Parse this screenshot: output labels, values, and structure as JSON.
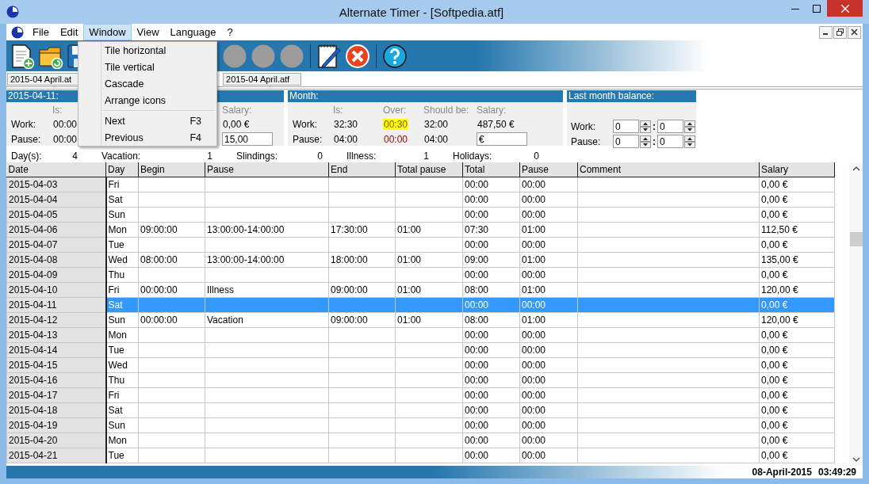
{
  "window": {
    "title": "Alternate Timer - [Softpedia.atf]"
  },
  "menu_bar": [
    {
      "label": "File",
      "selected": false
    },
    {
      "label": "Edit",
      "selected": false
    },
    {
      "label": "Window",
      "selected": true
    },
    {
      "label": "View",
      "selected": false
    },
    {
      "label": "Language",
      "selected": false
    },
    {
      "label": "?",
      "selected": false
    }
  ],
  "toolbar": [
    {
      "kind": "new"
    },
    {
      "kind": "open"
    },
    {
      "kind": "save"
    },
    {
      "kind": "disabled"
    },
    {
      "kind": "disabled"
    },
    {
      "kind": "disabled"
    },
    {
      "kind": "divider"
    },
    {
      "kind": "notes"
    },
    {
      "kind": "close"
    },
    {
      "kind": "divider"
    },
    {
      "kind": "help"
    }
  ],
  "document_tabs": [
    {
      "label": "2015-04 April.at"
    },
    {
      "label": "2015-04 April.atf"
    }
  ],
  "day_panel": {
    "title": "2015-04-11:",
    "headers": [
      "Is:",
      "Salary:"
    ],
    "rows": [
      {
        "label": "Work:",
        "is": "00:00",
        "salary": "0,00 €"
      },
      {
        "label": "Pause:",
        "is": "00:00",
        "salary_field": "15,00"
      }
    ]
  },
  "month_panel": {
    "title": "Month:",
    "headers": [
      "Is:",
      "Over:",
      "Should be:",
      "Salary:"
    ],
    "rows": [
      {
        "label": "Work:",
        "cells": [
          {
            "text": "32:30",
            "kind": "plain"
          },
          {
            "text": "00:30",
            "kind": "highlight"
          },
          {
            "text": "32:00",
            "kind": "plain"
          },
          {
            "text": "487,50 €",
            "kind": "plain"
          }
        ]
      },
      {
        "label": "Pause:",
        "cells": [
          {
            "text": "04:00",
            "kind": "plain"
          },
          {
            "text": "00:00",
            "kind": "alert"
          },
          {
            "text": "04:00",
            "kind": "plain"
          }
        ],
        "salary_field": "€"
      }
    ]
  },
  "balance_panel": {
    "title": "Last month balance:",
    "rows": [
      {
        "label": "Work:",
        "hours": "0",
        "separator": ":",
        "minutes": "0"
      },
      {
        "label": "Pause:",
        "hours": "0",
        "separator": ":",
        "minutes": "0"
      }
    ]
  },
  "summary": [
    {
      "label": "Day(s):",
      "value": "4"
    },
    {
      "label": "Vacation:",
      "value": "1"
    },
    {
      "label": "Slindings:",
      "value": "0"
    },
    {
      "label": "Illness:",
      "value": "1"
    },
    {
      "label": "Holidays:",
      "value": "0"
    }
  ],
  "table": {
    "columns": [
      "Date",
      "Day",
      "Begin",
      "Pause",
      "End",
      "Total pause",
      "Total",
      "Pause",
      "Comment",
      "Salary"
    ],
    "rows": [
      {
        "date": "2015-04-03",
        "day": "Fri",
        "total": "00:00",
        "pause_total": "00:00",
        "salary": "0,00 €",
        "selected": false
      },
      {
        "date": "2015-04-04",
        "day": "Sat",
        "total": "00:00",
        "pause_total": "00:00",
        "salary": "0,00 €",
        "selected": false
      },
      {
        "date": "2015-04-05",
        "day": "Sun",
        "total": "00:00",
        "pause_total": "00:00",
        "salary": "0,00 €",
        "selected": false
      },
      {
        "date": "2015-04-06",
        "day": "Mon",
        "begin": "09:00:00",
        "pause": "13:00:00-14:00:00",
        "end": "17:30:00",
        "total_pause": "01:00",
        "total": "07:30",
        "pause_total": "01:00",
        "salary": "112,50 €",
        "selected": false
      },
      {
        "date": "2015-04-07",
        "day": "Tue",
        "total": "00:00",
        "pause_total": "00:00",
        "salary": "0,00 €",
        "selected": false
      },
      {
        "date": "2015-04-08",
        "day": "Wed",
        "begin": "08:00:00",
        "pause": "13:00:00-14:00:00",
        "end": "18:00:00",
        "total_pause": "01:00",
        "total": "09:00",
        "pause_total": "01:00",
        "salary": "135,00 €",
        "selected": false
      },
      {
        "date": "2015-04-09",
        "day": "Thu",
        "total": "00:00",
        "pause_total": "00:00",
        "salary": "0,00 €",
        "selected": false
      },
      {
        "date": "2015-04-10",
        "day": "Fri",
        "begin": "00:00:00",
        "pause": "Illness",
        "end": "09:00:00",
        "total_pause": "01:00",
        "total": "08:00",
        "pause_total": "01:00",
        "salary": "120,00 €",
        "selected": false
      },
      {
        "date": "2015-04-11",
        "day": "Sat",
        "total": "00:00",
        "pause_total": "00:00",
        "salary": "0,00 €",
        "selected": true
      },
      {
        "date": "2015-04-12",
        "day": "Sun",
        "begin": "00:00:00",
        "pause": "Vacation",
        "end": "09:00:00",
        "total_pause": "01:00",
        "total": "08:00",
        "pause_total": "01:00",
        "salary": "120,00 €",
        "selected": false
      },
      {
        "date": "2015-04-13",
        "day": "Mon",
        "total": "00:00",
        "pause_total": "00:00",
        "salary": "0,00 €",
        "selected": false
      },
      {
        "date": "2015-04-14",
        "day": "Tue",
        "total": "00:00",
        "pause_total": "00:00",
        "salary": "0,00 €",
        "selected": false
      },
      {
        "date": "2015-04-15",
        "day": "Wed",
        "total": "00:00",
        "pause_total": "00:00",
        "salary": "0,00 €",
        "selected": false
      },
      {
        "date": "2015-04-16",
        "day": "Thu",
        "total": "00:00",
        "pause_total": "00:00",
        "salary": "0,00 €",
        "selected": false
      },
      {
        "date": "2015-04-17",
        "day": "Fri",
        "total": "00:00",
        "pause_total": "00:00",
        "salary": "0,00 €",
        "selected": false
      },
      {
        "date": "2015-04-18",
        "day": "Sat",
        "total": "00:00",
        "pause_total": "00:00",
        "salary": "0,00 €",
        "selected": false
      },
      {
        "date": "2015-04-19",
        "day": "Sun",
        "total": "00:00",
        "pause_total": "00:00",
        "salary": "0,00 €",
        "selected": false
      },
      {
        "date": "2015-04-20",
        "day": "Mon",
        "total": "00:00",
        "pause_total": "00:00",
        "salary": "0,00 €",
        "selected": false
      },
      {
        "date": "2015-04-21",
        "day": "Tue",
        "total": "00:00",
        "pause_total": "00:00",
        "salary": "0,00 €",
        "selected": false
      }
    ]
  },
  "status_bar": {
    "date": "08-April-2015",
    "time": "03:49:29"
  },
  "window_menu": [
    {
      "kind": "item",
      "label": "Tile horizontal"
    },
    {
      "kind": "item",
      "label": "Tile vertical"
    },
    {
      "kind": "item",
      "label": "Cascade"
    },
    {
      "kind": "item",
      "label": "Arrange icons"
    },
    {
      "kind": "separator"
    },
    {
      "kind": "item",
      "label": "Next",
      "shortcut": "F3"
    },
    {
      "kind": "item",
      "label": "Previous",
      "shortcut": "F4"
    }
  ]
}
